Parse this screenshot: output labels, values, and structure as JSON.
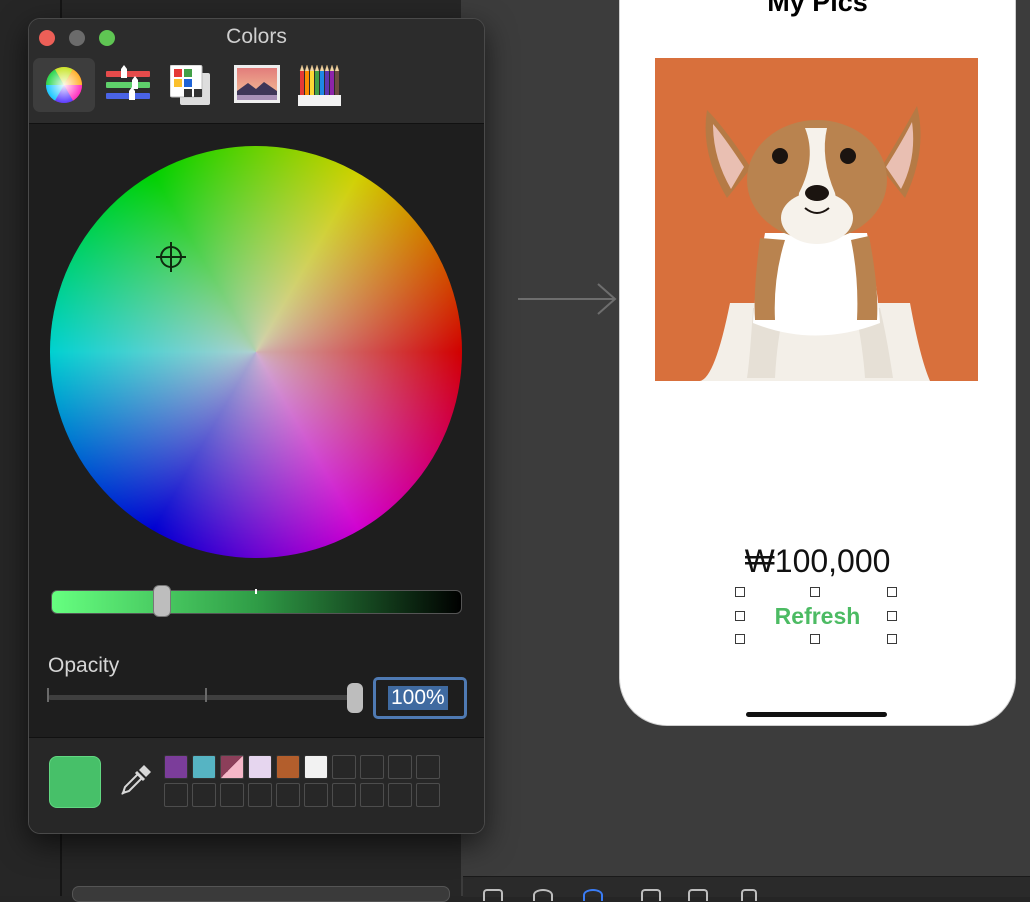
{
  "colors_panel": {
    "title": "Colors",
    "window_controls": [
      "close",
      "minimize",
      "zoom"
    ],
    "modes": [
      {
        "name": "color-wheel",
        "icon": "color-wheel-icon",
        "active": true
      },
      {
        "name": "color-sliders",
        "icon": "sliders-icon",
        "active": false
      },
      {
        "name": "color-palettes",
        "icon": "palettes-icon",
        "active": false
      },
      {
        "name": "image-palettes",
        "icon": "image-palette-icon",
        "active": false
      },
      {
        "name": "pencils",
        "icon": "pencils-icon",
        "active": false
      }
    ],
    "brightness_level": 0.27,
    "opacity_label": "Opacity",
    "opacity_value": "100%",
    "current_color": "#47c069",
    "eyedropper_icon": "eyedropper-icon",
    "swatches": [
      "#7b3d9a",
      "#56b4c3",
      "split:#8c3f5a/#f5b7c8",
      "#e6d6ef",
      "#b35e2c",
      "#f2f2f2",
      "",
      "",
      "",
      "",
      "",
      "",
      "",
      "",
      "",
      "",
      "",
      "",
      "",
      ""
    ]
  },
  "phone": {
    "title": "My Pics",
    "image_alt": "puppy photo",
    "price": "₩100,000",
    "refresh_label": "Refresh",
    "refresh_color": "#4cbb63"
  }
}
